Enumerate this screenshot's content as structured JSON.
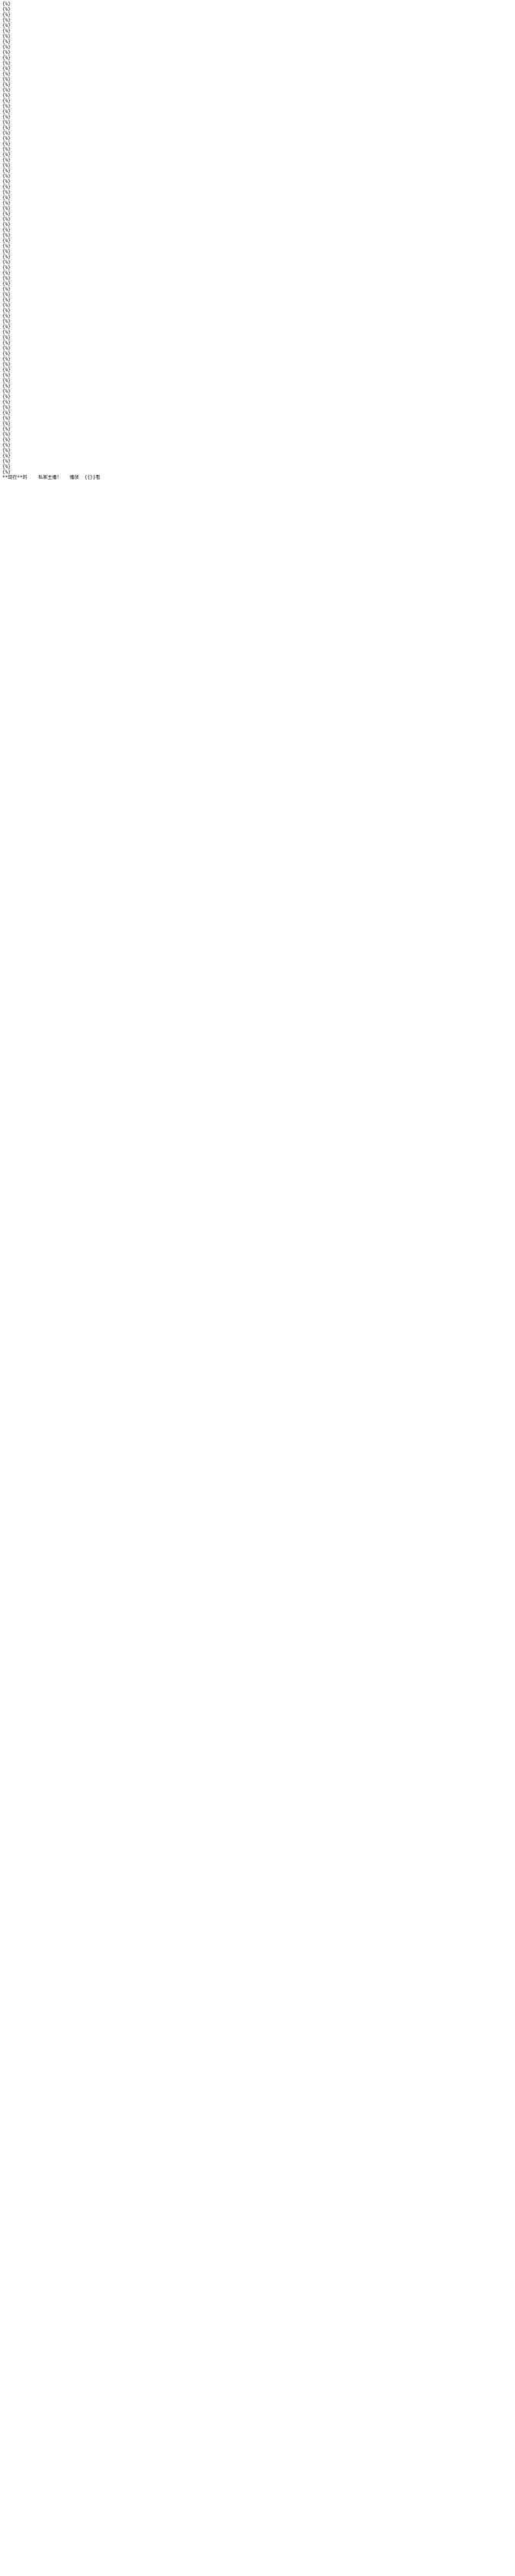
{
  "document": {
    "lines": [
      "{%}",
      "{%}",
      "{%}",
      "{%}",
      "{%}",
      "{%}",
      "{%}",
      "{%}",
      "{%}",
      "{%}",
      "{%}",
      "{%}",
      "{%}",
      "{%}",
      "{%}",
      "{%}",
      "{%}",
      "{%}",
      "{%}",
      "{%}",
      "{%}",
      "{%}",
      "{%}",
      "{%}",
      "{%}",
      "{%}",
      "{%}",
      "{%}",
      "{%}",
      "{%}",
      "{%}",
      "{%}",
      "{%}",
      "{%}",
      "{%}",
      "{%}",
      "{%}",
      "{%}",
      "{%}",
      "{%}",
      "{%}",
      "{%}",
      "{%}",
      "{%}",
      "{%}",
      "{%}",
      "{%}",
      "{%}",
      "{%}",
      "{%}",
      "{%}",
      "{%}",
      "{%}",
      "{%}",
      "{%}",
      "{%}",
      "{%}",
      "{%}",
      "{%}",
      "{%}",
      "{%}",
      "{%}",
      "{%}",
      "{%}",
      "{%}",
      "{%}",
      "{%}",
      "{%}",
      "{%}",
      "{%}",
      "{%}",
      "{%}",
      "{%}",
      "{%}",
      "{%}",
      "{%}",
      "{%}",
      "{%}",
      "{%}",
      "{%}",
      "{%}",
      "{%}",
      "{%}",
      "{%}",
      "{%}",
      "{%}",
      "{%}",
      "{%}",
      "**现在**的    私家主播！   播放  {{}}看"
    ]
  }
}
